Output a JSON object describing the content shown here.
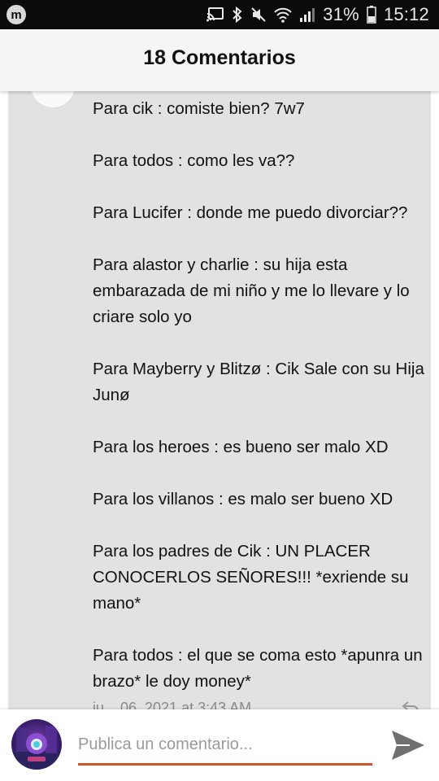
{
  "status_bar": {
    "battery_percent": "31%",
    "time": "15:12",
    "icons": [
      "cast-icon",
      "bluetooth-icon",
      "mute-icon",
      "wifi-icon",
      "signal-icon",
      "battery-icon"
    ]
  },
  "header": {
    "title": "18 Comentarios"
  },
  "comment": {
    "lines": [
      "Para cik : comiste bien? 7w7",
      "Para todos : como les va??",
      "Para Lucifer : donde me puedo divorciar??",
      "Para alastor y charlie : su hija esta",
      "embarazada de mi niño y me lo llevare y lo",
      "criare solo yo",
      "Para Mayberry y Blitzø : Cik Sale con su Hija",
      "Junø",
      "Para los heroes : es bueno ser malo XD",
      "Para los villanos : es malo ser bueno XD",
      "Para los padres de Cik : UN PLACER",
      "CONOCERLOS SEÑORES!!! *exriende su",
      "mano*",
      "Para todos : el que se coma esto *apunra un",
      "brazo* le doy money*"
    ],
    "timestamp": "ju... 06, 2021 at 3:43 AM"
  },
  "composer": {
    "placeholder": "Publica un comentario...",
    "accent_color": "#d2532a"
  },
  "colors": {
    "card_bg": "#e2e2e2",
    "header_bg": "#f5f5f5",
    "status_bg": "#0b0b0b"
  }
}
